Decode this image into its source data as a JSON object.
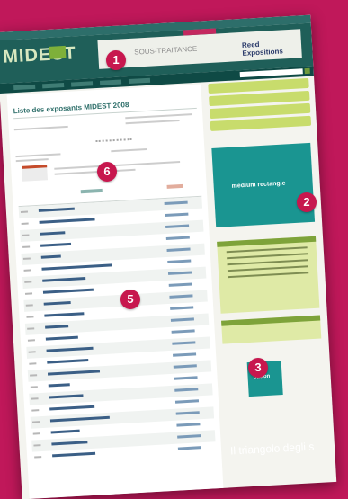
{
  "brand": {
    "name": "MIDEST"
  },
  "ad": {
    "text": "SOUS-TRAITANCE",
    "logo": "Reed Expositions"
  },
  "page": {
    "title": "Liste des exposants MIDEST 2008"
  },
  "sidebar": {
    "pills": [
      "",
      "",
      "",
      ""
    ],
    "medium_rectangle_label": "medium rectangle",
    "button_label": "button"
  },
  "markers": [
    "1",
    "2",
    "3",
    "5",
    "6"
  ],
  "caption": "Il triangolo degli s",
  "colors": {
    "background": "#c0185a",
    "marker": "#c7174e",
    "teal": "#1a9591",
    "lime": "#c8dc6c"
  }
}
